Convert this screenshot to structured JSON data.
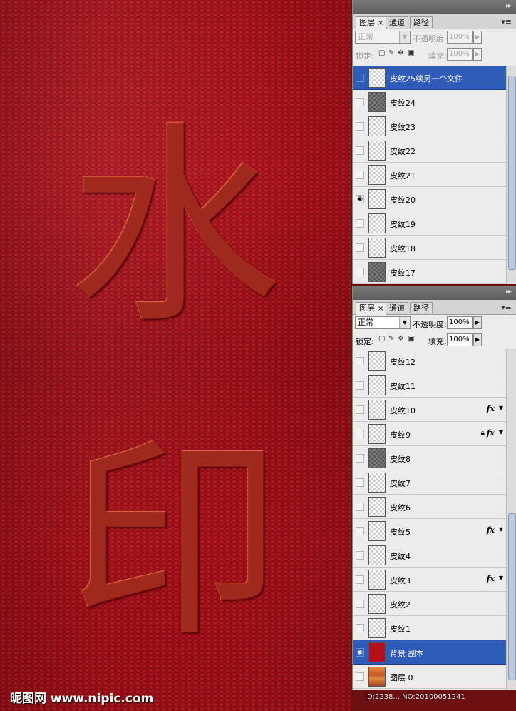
{
  "canvas": {
    "char1": "水",
    "char2": "印",
    "watermark": "昵图网 www.nipic.com",
    "id_text": "ID:2238... NO:20100051241"
  },
  "panel_top": {
    "tabs": [
      "图层",
      "通道",
      "路径"
    ],
    "blend_mode": "正常",
    "opacity_label": "不透明度:",
    "opacity_value": "100%",
    "lock_label": "锁定:",
    "fill_label": "填充:",
    "fill_value": "100%",
    "layers": [
      {
        "name": "皮纹25续另一个文件",
        "selected": true,
        "thumb": "light"
      },
      {
        "name": "皮纹24",
        "thumb": "dark"
      },
      {
        "name": "皮纹23",
        "thumb": "light"
      },
      {
        "name": "皮纹22",
        "thumb": "light"
      },
      {
        "name": "皮纹21",
        "thumb": "light"
      },
      {
        "name": "皮纹20",
        "visible": true,
        "thumb": "light"
      },
      {
        "name": "皮纹19",
        "thumb": "light"
      },
      {
        "name": "皮纹18",
        "thumb": "light"
      },
      {
        "name": "皮纹17",
        "thumb": "dark"
      }
    ]
  },
  "panel_bottom": {
    "tabs": [
      "图层",
      "通道",
      "路径"
    ],
    "blend_mode": "正常",
    "opacity_label": "不透明度:",
    "opacity_value": "100%",
    "lock_label": "锁定:",
    "fill_label": "填充:",
    "fill_value": "100%",
    "fx_label": "fx",
    "layers": [
      {
        "name": "皮纹12",
        "thumb": "light"
      },
      {
        "name": "皮纹11",
        "thumb": "light"
      },
      {
        "name": "皮纹10",
        "thumb": "light",
        "fx": true
      },
      {
        "name": "皮纹9",
        "thumb": "light",
        "fx": true,
        "locked": true
      },
      {
        "name": "皮纹8",
        "thumb": "dark"
      },
      {
        "name": "皮纹7",
        "thumb": "light"
      },
      {
        "name": "皮纹6",
        "thumb": "light"
      },
      {
        "name": "皮纹5",
        "thumb": "light",
        "fx": true
      },
      {
        "name": "皮纹4",
        "thumb": "light"
      },
      {
        "name": "皮纹3",
        "thumb": "light",
        "fx": true
      },
      {
        "name": "皮纹2",
        "thumb": "light"
      },
      {
        "name": "皮纹1",
        "thumb": "light"
      },
      {
        "name": "背景 副本",
        "thumb": "red",
        "visible": true,
        "selected": true
      },
      {
        "name": "图层 0",
        "thumb": "orange"
      }
    ]
  }
}
